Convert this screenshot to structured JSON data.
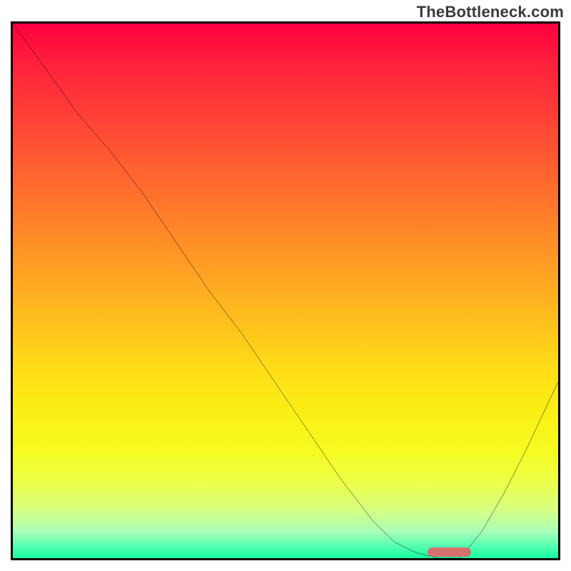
{
  "watermark": "TheBottleneck.com",
  "chart_data": {
    "type": "line",
    "title": "",
    "xlabel": "",
    "ylabel": "",
    "xlim": [
      0,
      100
    ],
    "ylim": [
      0,
      100
    ],
    "grid": false,
    "legend": false,
    "series": [
      {
        "name": "curve",
        "x": [
          0,
          5,
          12,
          18,
          24,
          30,
          36,
          42,
          48,
          54,
          60,
          66,
          70,
          74,
          78,
          82,
          86,
          90,
          94,
          100
        ],
        "y": [
          100,
          93,
          83,
          76,
          68,
          59,
          50,
          42,
          33,
          24,
          15,
          7,
          3,
          1,
          0,
          0,
          5,
          12,
          20,
          33
        ]
      }
    ],
    "marker": {
      "x_start": 76,
      "x_end": 84,
      "y": 0,
      "color": "#d6706e"
    },
    "background_gradient": {
      "top": "#ff0040",
      "bottom": "#14ff9e"
    }
  }
}
